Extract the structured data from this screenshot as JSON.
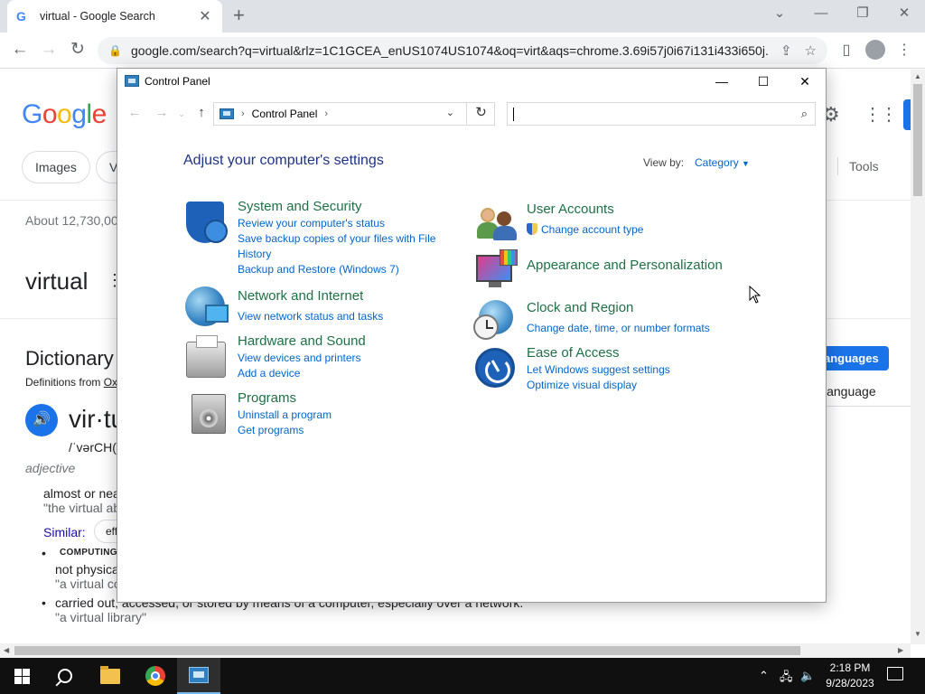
{
  "browser": {
    "tab_title": "virtual - Google Search",
    "tab_favicon": "G",
    "url": "google.com/search?q=virtual&rlz=1C1GCEA_enUS1074US1074&oq=virt&aqs=chrome.3.69i57j0i67i131i433i650j..."
  },
  "google": {
    "logo": [
      "G",
      "o",
      "o",
      "g",
      "l",
      "e"
    ],
    "chips": [
      "Images",
      "V"
    ],
    "tools": "Tools",
    "result_stats": "About 12,730,00",
    "query": "virtual",
    "dict_title": "Dictionary",
    "dict_from_prefix": "Definitions from ",
    "dict_from_link": "Ox",
    "word": "vir·tu",
    "phonetic": "/ˈvərCH(",
    "part_of_speech": "adjective",
    "def1": "almost or nea",
    "def1_example": "\"the virtual ab",
    "similar_label": "Similar:",
    "similar_chip": "eff",
    "computing_label": "COMPUTING",
    "def2": "not physica",
    "def2_example": "\"a virtual co",
    "def3": "carried out, accessed, or stored by means of a computer, especially over a network.",
    "def3_example": "\"a virtual library\"",
    "languages_btn": "anguages",
    "language_label": "language"
  },
  "control_panel": {
    "window_title": "Control Panel",
    "breadcrumb": "Control Panel",
    "heading": "Adjust your computer's settings",
    "view_by_label": "View by:",
    "view_by_value": "Category",
    "categories": {
      "system": {
        "title": "System and Security",
        "links": [
          "Review your computer's status",
          "Save backup copies of your files with File",
          "History",
          "Backup and Restore (Windows 7)"
        ]
      },
      "network": {
        "title": "Network and Internet",
        "links": [
          "View network status and tasks"
        ]
      },
      "hardware": {
        "title": "Hardware and Sound",
        "links": [
          "View devices and printers",
          "Add a device"
        ]
      },
      "programs": {
        "title": "Programs",
        "links": [
          "Uninstall a program",
          "Get programs"
        ]
      },
      "users": {
        "title": "User Accounts",
        "links": [
          "Change account type"
        ]
      },
      "appearance": {
        "title": "Appearance and Personalization",
        "links": []
      },
      "clock": {
        "title": "Clock and Region",
        "links": [
          "Change date, time, or number formats"
        ]
      },
      "ease": {
        "title": "Ease of Access",
        "links": [
          "Let Windows suggest settings",
          "Optimize visual display"
        ]
      }
    }
  },
  "taskbar": {
    "time": "2:18 PM",
    "date": "9/28/2023"
  }
}
